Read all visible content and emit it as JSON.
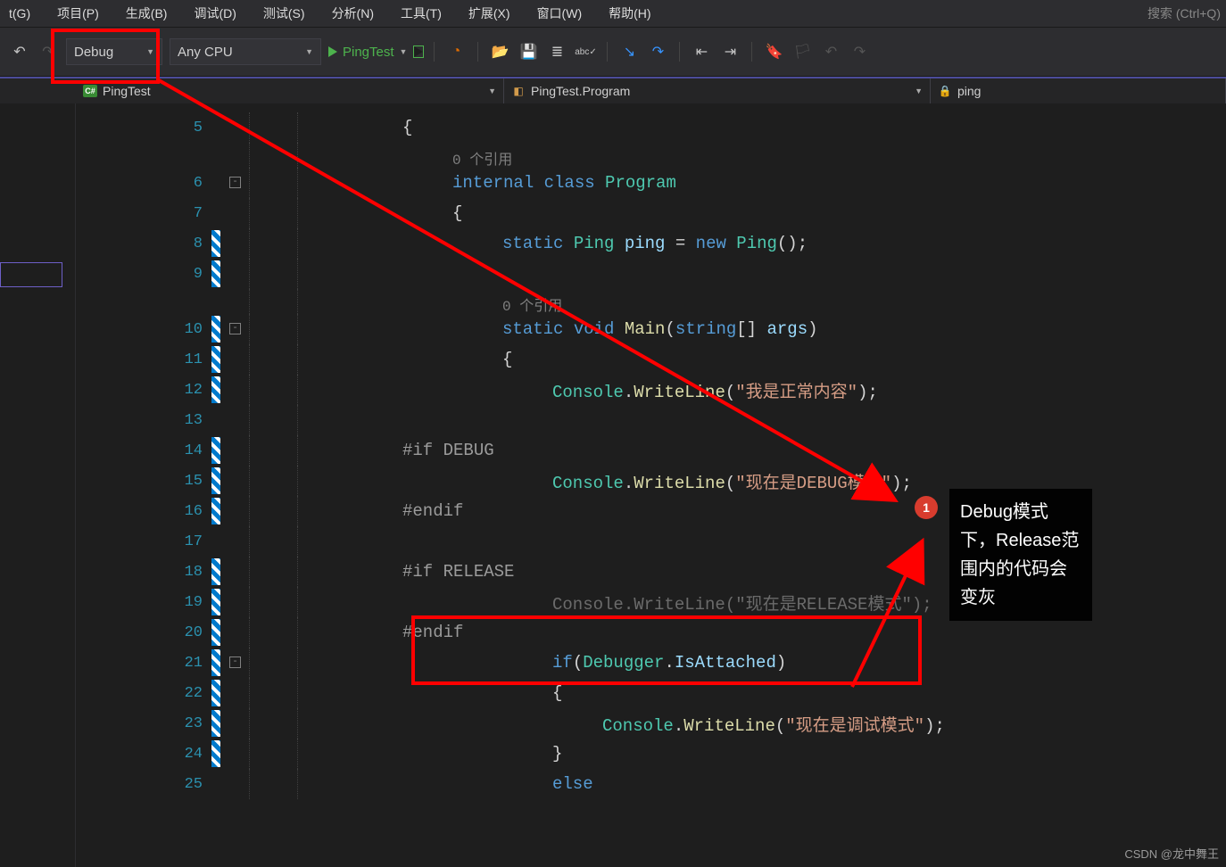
{
  "menu": {
    "items": [
      "t(G)",
      "项目(P)",
      "生成(B)",
      "调试(D)",
      "测试(S)",
      "分析(N)",
      "工具(T)",
      "扩展(X)",
      "窗口(W)",
      "帮助(H)"
    ],
    "search_placeholder": "搜索 (Ctrl+Q)"
  },
  "toolbar": {
    "config": "Debug",
    "platform": "Any CPU",
    "run_label": "PingTest"
  },
  "nav": {
    "project": "PingTest",
    "class": "PingTest.Program",
    "member": "ping"
  },
  "code": {
    "lines": [
      {
        "n": 5,
        "ind": 1,
        "kind": "brace",
        "t": "{"
      },
      {
        "n": "",
        "ind": 2,
        "kind": "ref",
        "t": "0 个引用"
      },
      {
        "n": 6,
        "ind": 2,
        "kind": "cls",
        "kw1": "internal",
        "kw2": "class",
        "ty": "Program",
        "fold": true
      },
      {
        "n": 7,
        "ind": 2,
        "kind": "brace",
        "t": "{"
      },
      {
        "n": 8,
        "ind": 3,
        "kind": "decl",
        "kw": "static",
        "ty": "Ping",
        "id": "ping",
        "op": " = ",
        "kw2": "new",
        "ty2": "Ping",
        "tail": "();",
        "bar": true
      },
      {
        "n": 9,
        "ind": 3,
        "kind": "blank",
        "bar": true
      },
      {
        "n": "",
        "ind": 3,
        "kind": "ref",
        "t": "0 个引用"
      },
      {
        "n": 10,
        "ind": 3,
        "kind": "main",
        "kw": "static",
        "kw2": "void",
        "md": "Main",
        "args": "(string[] args)",
        "bar": true,
        "fold": true
      },
      {
        "n": 11,
        "ind": 3,
        "kind": "brace",
        "t": "{",
        "bar": true
      },
      {
        "n": 12,
        "ind": 4,
        "kind": "call",
        "cls": "Console",
        "dot": ".",
        "md": "WriteLine",
        "args": "(\"我是正常内容\");",
        "bar": true
      },
      {
        "n": 13,
        "ind": 4,
        "kind": "blank"
      },
      {
        "n": 14,
        "ind": 1,
        "kind": "pp",
        "t": "#if DEBUG",
        "bar": true
      },
      {
        "n": 15,
        "ind": 4,
        "kind": "call",
        "cls": "Console",
        "dot": ".",
        "md": "WriteLine",
        "args": "(\"现在是DEBUG模式\");",
        "bar": true
      },
      {
        "n": 16,
        "ind": 1,
        "kind": "pp",
        "t": "#endif",
        "bar": true
      },
      {
        "n": 17,
        "ind": 4,
        "kind": "blank"
      },
      {
        "n": 18,
        "ind": 1,
        "kind": "pp",
        "t": "#if RELEASE",
        "bar": true
      },
      {
        "n": 19,
        "ind": 4,
        "kind": "dim",
        "t": "Console.WriteLine(\"现在是RELEASE模式\");",
        "bar": true
      },
      {
        "n": 20,
        "ind": 1,
        "kind": "pp",
        "t": "#endif",
        "bar": true
      },
      {
        "n": 21,
        "ind": 4,
        "kind": "if",
        "kw": "if",
        "args": "(Debugger.IsAttached)",
        "bar": true,
        "fold": true
      },
      {
        "n": 22,
        "ind": 4,
        "kind": "brace",
        "t": "{",
        "bar": true
      },
      {
        "n": 23,
        "ind": 5,
        "kind": "call",
        "cls": "Console",
        "dot": ".",
        "md": "WriteLine",
        "args": "(\"现在是调试模式\");",
        "bar": true
      },
      {
        "n": 24,
        "ind": 4,
        "kind": "brace",
        "t": "}",
        "bar": true
      },
      {
        "n": 25,
        "ind": 4,
        "kind": "else",
        "kw": "else"
      }
    ]
  },
  "annotation": {
    "badge": "1",
    "note": "Debug模式下，Release范围内的代码会变灰",
    "watermark": "CSDN @龙中舞王"
  }
}
